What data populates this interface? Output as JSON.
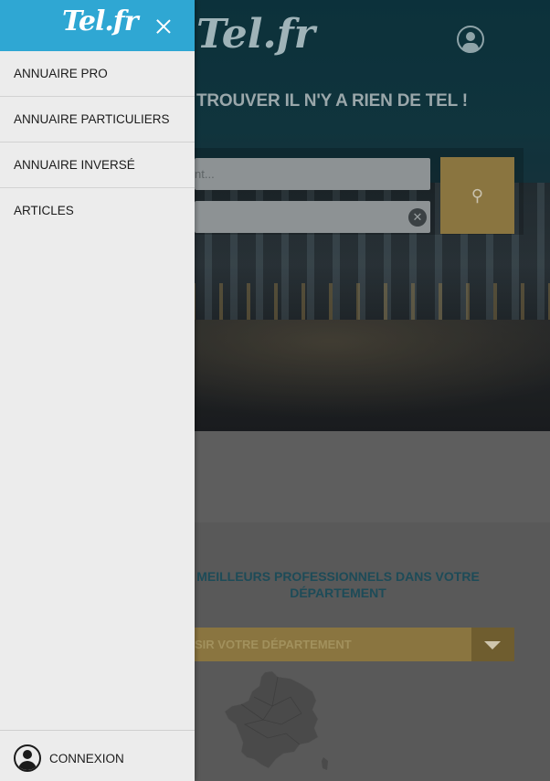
{
  "background": {
    "logo_text": "Tel.fr",
    "tagline": "TROUVER IL N'Y A RIEN DE TEL !",
    "search_placeholder_partial": "nt...",
    "promo_text": "MEILLEURS PROFESSIONNELS DANS VOTRE DÉPARTEMENT",
    "department_select_partial": "SIR VOTRE DÉPARTEMENT"
  },
  "drawer": {
    "logo_text": "Tel.fr",
    "menu": [
      {
        "label": "ANNUAIRE PRO"
      },
      {
        "label": "ANNUAIRE PARTICULIERS"
      },
      {
        "label": "ANNUAIRE INVERSÉ"
      },
      {
        "label": "ARTICLES"
      }
    ],
    "footer": {
      "label": "CONNEXION"
    }
  },
  "colors": {
    "drawer_header": "#2fa7d3",
    "drawer_bg": "#ececec",
    "accent_yellow": "#8a7540",
    "hero_teal": "#0f3c48"
  },
  "icons": [
    "close-icon",
    "user-icon",
    "search-icon",
    "clear-icon",
    "chevron-down-icon"
  ]
}
